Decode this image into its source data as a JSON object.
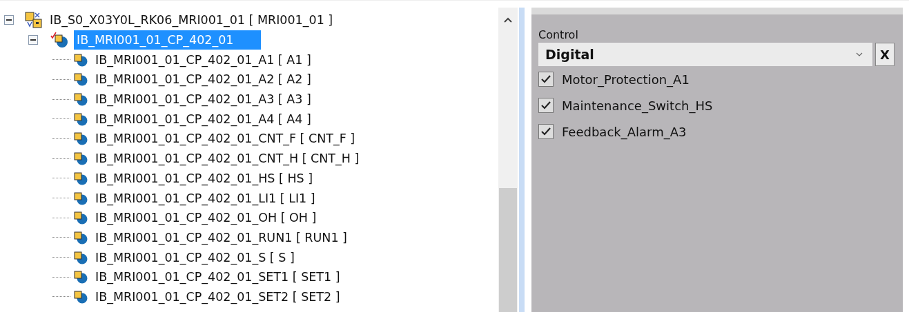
{
  "tree": [
    {
      "label": "IB_S0_X03Y0L_RK06_MRI001_01 [ MRI001_01 ]",
      "kind": "rack",
      "expanded": true,
      "selected": false,
      "children": [
        {
          "label": "IB_MRI001_01_CP_402_01",
          "kind": "module",
          "expanded": true,
          "selected": true,
          "children": [
            {
              "label": "IB_MRI001_01_CP_402_01_A1 [ A1 ]",
              "kind": "signal",
              "selected": false
            },
            {
              "label": "IB_MRI001_01_CP_402_01_A2 [ A2 ]",
              "kind": "signal",
              "selected": false
            },
            {
              "label": "IB_MRI001_01_CP_402_01_A3 [ A3 ]",
              "kind": "signal",
              "selected": false
            },
            {
              "label": "IB_MRI001_01_CP_402_01_A4 [ A4 ]",
              "kind": "signal",
              "selected": false
            },
            {
              "label": "IB_MRI001_01_CP_402_01_CNT_F [ CNT_F ]",
              "kind": "signal",
              "selected": false
            },
            {
              "label": "IB_MRI001_01_CP_402_01_CNT_H [ CNT_H ]",
              "kind": "signal",
              "selected": false
            },
            {
              "label": "IB_MRI001_01_CP_402_01_HS [ HS ]",
              "kind": "signal",
              "selected": false
            },
            {
              "label": "IB_MRI001_01_CP_402_01_LI1 [ LI1 ]",
              "kind": "signal",
              "selected": false
            },
            {
              "label": "IB_MRI001_01_CP_402_01_OH [ OH ]",
              "kind": "signal",
              "selected": false
            },
            {
              "label": "IB_MRI001_01_CP_402_01_RUN1 [ RUN1 ]",
              "kind": "signal",
              "selected": false
            },
            {
              "label": "IB_MRI001_01_CP_402_01_S [ S ]",
              "kind": "signal",
              "selected": false
            },
            {
              "label": "IB_MRI001_01_CP_402_01_SET1 [ SET1 ]",
              "kind": "signal",
              "selected": false
            },
            {
              "label": "IB_MRI001_01_CP_402_01_SET2 [ SET2 ]",
              "kind": "signal",
              "selected": false
            }
          ]
        }
      ]
    }
  ],
  "control": {
    "label": "Control",
    "value": "Digital",
    "clear": "X",
    "options": [
      {
        "label": "Motor_Protection_A1",
        "checked": true
      },
      {
        "label": "Maintenance_Switch_HS",
        "checked": true
      },
      {
        "label": "Feedback_Alarm_A3",
        "checked": true
      }
    ]
  }
}
